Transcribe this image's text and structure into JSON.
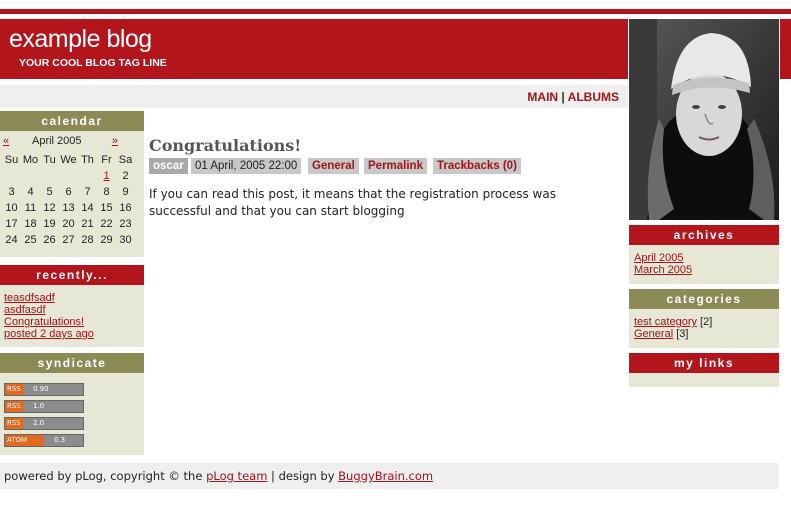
{
  "header": {
    "title": "example blog",
    "tagline": "YOUR COOL BLOG TAG LINE"
  },
  "nav": {
    "main": "MAIN",
    "separator": "|",
    "albums": "ALBUMS"
  },
  "calendar": {
    "heading": "calendar",
    "prev": "«",
    "next": "»",
    "month": "April 2005",
    "weekdays": [
      "Su",
      "Mo",
      "Tu",
      "We",
      "Th",
      "Fr",
      "Sa"
    ],
    "weeks": [
      [
        "",
        "",
        "",
        "",
        "",
        "1",
        "2"
      ],
      [
        "3",
        "4",
        "5",
        "6",
        "7",
        "8",
        "9"
      ],
      [
        "10",
        "11",
        "12",
        "13",
        "14",
        "15",
        "16"
      ],
      [
        "17",
        "18",
        "19",
        "20",
        "21",
        "22",
        "23"
      ],
      [
        "24",
        "25",
        "26",
        "27",
        "28",
        "29",
        "30"
      ]
    ],
    "linked_day": "1"
  },
  "recently": {
    "heading": "recently...",
    "items": [
      "teasdfsadf",
      "asdfasdf",
      "Congratulations!",
      "posted 2 days ago"
    ]
  },
  "syndicate": {
    "heading": "syndicate",
    "feeds": [
      {
        "type": "RSS",
        "version": "0.90"
      },
      {
        "type": "RSS",
        "version": "1.0"
      },
      {
        "type": "RSS",
        "version": "2.0"
      },
      {
        "type": "ATOM",
        "version": "0.3"
      }
    ]
  },
  "post": {
    "title": "Congratulations!",
    "author": "oscar",
    "date": "01 April, 2005 22:00",
    "category": "General",
    "permalink": "Permalink",
    "trackbacks": "Trackbacks (0)",
    "body": "If you can read this post, it means that the registration process was successful and that you can start blogging"
  },
  "archives": {
    "heading": "archives",
    "items": [
      "April 2005",
      "March 2005"
    ]
  },
  "categories": {
    "heading": "categories",
    "items": [
      {
        "name": "test category",
        "count": "[2]"
      },
      {
        "name": "General",
        "count": "[3]"
      }
    ]
  },
  "mylinks": {
    "heading": "my links"
  },
  "footer": {
    "text1": "powered by pLog, copyright © the ",
    "link1": "pLog team",
    "text2": " | design by ",
    "link2": "BuggyBrain.com"
  },
  "colors": {
    "brand_red": "#b2151b",
    "olive": "#8c8b55",
    "sidebar_bg": "#e6e7d5",
    "link": "#a1141a"
  }
}
